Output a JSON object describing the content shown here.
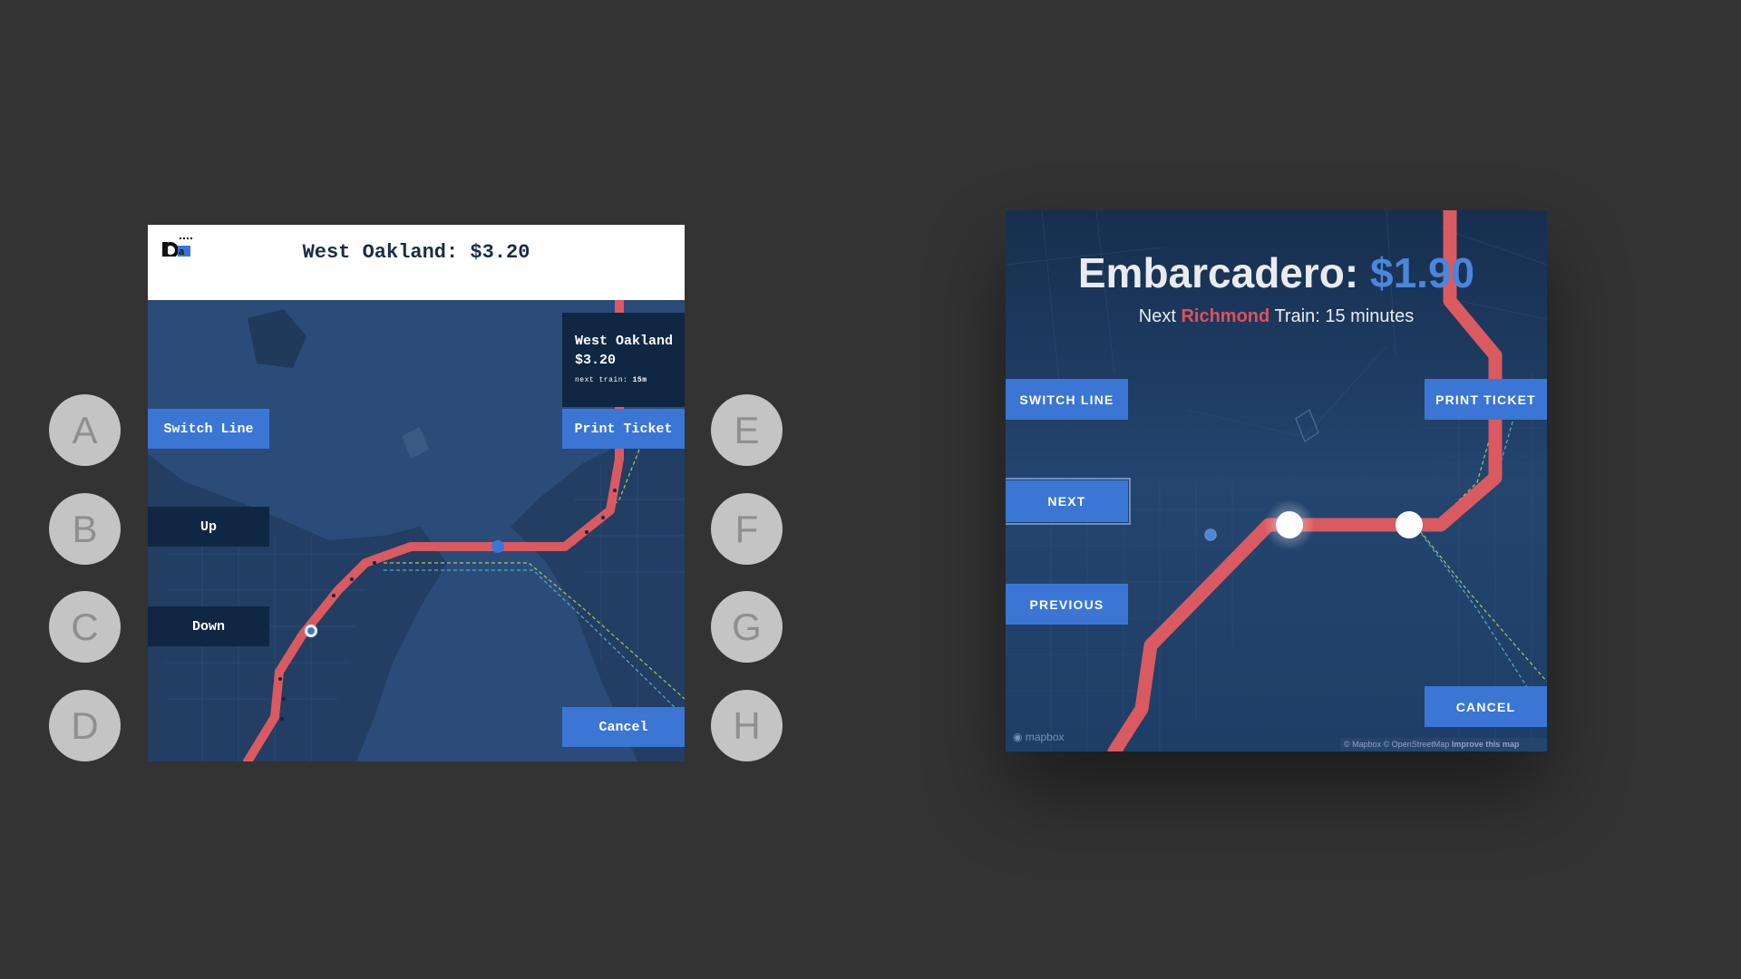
{
  "side_buttons": {
    "left": [
      "A",
      "B",
      "C",
      "D"
    ],
    "right": [
      "E",
      "F",
      "G",
      "H"
    ]
  },
  "kiosk_left": {
    "header_title": "West Oakland: $3.20",
    "info_card": {
      "station": "West Oakland",
      "price": "$3.20",
      "next_train_label": "next train:",
      "next_train_value": "15m"
    },
    "buttons": {
      "switch_line": "Switch Line",
      "up": "Up",
      "down": "Down",
      "print_ticket": "Print Ticket",
      "cancel": "Cancel"
    }
  },
  "kiosk_right": {
    "title_station": "Embarcadero:",
    "title_price": "$1.90",
    "subtitle_prefix": "Next",
    "subtitle_line": "Richmond",
    "subtitle_suffix": "Train: 15 minutes",
    "buttons": {
      "switch_line": "SWITCH LINE",
      "next": "NEXT",
      "previous": "PREVIOUS",
      "print_ticket": "PRINT TICKET",
      "cancel": "CANCEL"
    },
    "map_brand": "mapbox",
    "attribution": "© Mapbox © OpenStreetMap",
    "improve_link": "Improve this map"
  },
  "colors": {
    "background": "#333333",
    "button_blue": "#3b76d4",
    "button_navy": "#0f2743",
    "map_water": "#2b4c78",
    "map_land": "#223e63",
    "rail_red": "#d95a60",
    "price_blue": "#4a86dc",
    "line_red": "#e0505c"
  }
}
